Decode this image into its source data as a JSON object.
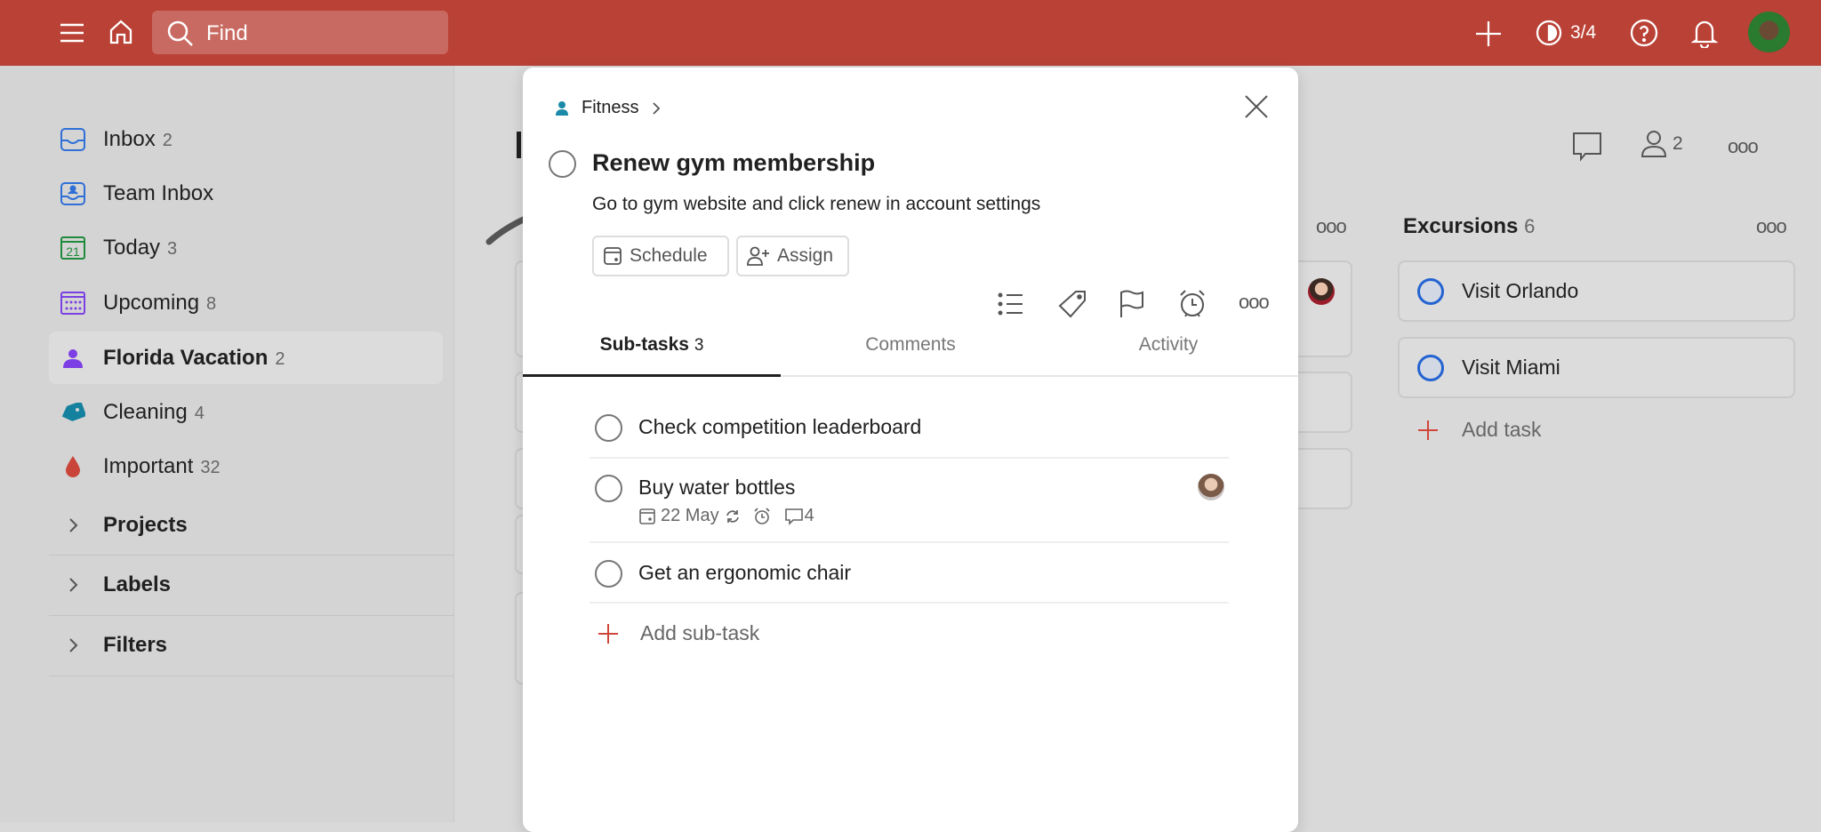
{
  "topbar": {
    "search_placeholder": "Find",
    "karma": "3/4",
    "icons": [
      "menu-icon",
      "home-icon",
      "search-icon",
      "plus-icon",
      "karma-icon",
      "help-icon",
      "bell-icon",
      "avatar"
    ],
    "color": "#ba4136"
  },
  "sidebar": {
    "items": [
      {
        "label": "Inbox",
        "count": "2",
        "icon": "inbox-icon",
        "color": "#2f6fd6"
      },
      {
        "label": "Team Inbox",
        "count": "",
        "icon": "team-inbox-icon",
        "color": "#2f6fd6"
      },
      {
        "label": "Today",
        "count": "3",
        "icon": "calendar-today-icon",
        "color": "#1f8a3a",
        "day": "21"
      },
      {
        "label": "Upcoming",
        "count": "8",
        "icon": "calendar-upcoming-icon",
        "color": "#7b3fe4"
      },
      {
        "label": "Florida Vacation",
        "count": "2",
        "icon": "person-icon",
        "color": "#7b3fe4",
        "active": true
      },
      {
        "label": "Cleaning",
        "count": "4",
        "icon": "tag-icon",
        "color": "#14829e"
      },
      {
        "label": "Important",
        "count": "32",
        "icon": "drop-icon",
        "color": "#d0453a"
      }
    ],
    "sections": [
      "Projects",
      "Labels",
      "Filters"
    ]
  },
  "main": {
    "collaborators": "2",
    "columns": [
      {
        "title": "Excursions",
        "count": "6",
        "tasks": [
          "Visit Orlando",
          "Visit Miami"
        ],
        "add_label": "Add task"
      }
    ]
  },
  "modal": {
    "breadcrumb": "Fitness",
    "title": "Renew gym membership",
    "description": "Go to gym website and click renew in account settings",
    "schedule_label": "Schedule",
    "assign_label": "Assign",
    "tabs": [
      {
        "label": "Sub-tasks",
        "count": "3",
        "active": true
      },
      {
        "label": "Comments"
      },
      {
        "label": "Activity"
      }
    ],
    "subtasks": [
      {
        "title": "Check competition leaderboard"
      },
      {
        "title": "Buy water bottles",
        "date": "22 May",
        "comments": "4",
        "recurring": true,
        "reminder": true,
        "assignee": true
      },
      {
        "title": "Get an ergonomic chair"
      }
    ],
    "add_subtask": "Add sub-task"
  }
}
